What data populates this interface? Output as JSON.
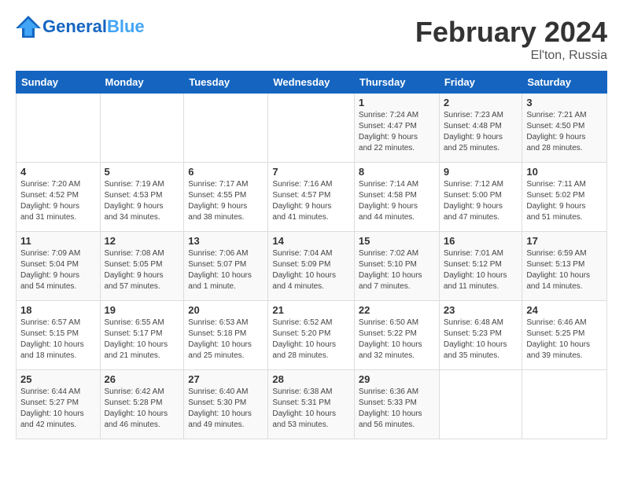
{
  "header": {
    "logo_general": "General",
    "logo_blue": "Blue",
    "month_year": "February 2024",
    "location": "El'ton, Russia"
  },
  "days_of_week": [
    "Sunday",
    "Monday",
    "Tuesday",
    "Wednesday",
    "Thursday",
    "Friday",
    "Saturday"
  ],
  "weeks": [
    [
      {
        "day": "",
        "info": ""
      },
      {
        "day": "",
        "info": ""
      },
      {
        "day": "",
        "info": ""
      },
      {
        "day": "",
        "info": ""
      },
      {
        "day": "1",
        "info": "Sunrise: 7:24 AM\nSunset: 4:47 PM\nDaylight: 9 hours\nand 22 minutes."
      },
      {
        "day": "2",
        "info": "Sunrise: 7:23 AM\nSunset: 4:48 PM\nDaylight: 9 hours\nand 25 minutes."
      },
      {
        "day": "3",
        "info": "Sunrise: 7:21 AM\nSunset: 4:50 PM\nDaylight: 9 hours\nand 28 minutes."
      }
    ],
    [
      {
        "day": "4",
        "info": "Sunrise: 7:20 AM\nSunset: 4:52 PM\nDaylight: 9 hours\nand 31 minutes."
      },
      {
        "day": "5",
        "info": "Sunrise: 7:19 AM\nSunset: 4:53 PM\nDaylight: 9 hours\nand 34 minutes."
      },
      {
        "day": "6",
        "info": "Sunrise: 7:17 AM\nSunset: 4:55 PM\nDaylight: 9 hours\nand 38 minutes."
      },
      {
        "day": "7",
        "info": "Sunrise: 7:16 AM\nSunset: 4:57 PM\nDaylight: 9 hours\nand 41 minutes."
      },
      {
        "day": "8",
        "info": "Sunrise: 7:14 AM\nSunset: 4:58 PM\nDaylight: 9 hours\nand 44 minutes."
      },
      {
        "day": "9",
        "info": "Sunrise: 7:12 AM\nSunset: 5:00 PM\nDaylight: 9 hours\nand 47 minutes."
      },
      {
        "day": "10",
        "info": "Sunrise: 7:11 AM\nSunset: 5:02 PM\nDaylight: 9 hours\nand 51 minutes."
      }
    ],
    [
      {
        "day": "11",
        "info": "Sunrise: 7:09 AM\nSunset: 5:04 PM\nDaylight: 9 hours\nand 54 minutes."
      },
      {
        "day": "12",
        "info": "Sunrise: 7:08 AM\nSunset: 5:05 PM\nDaylight: 9 hours\nand 57 minutes."
      },
      {
        "day": "13",
        "info": "Sunrise: 7:06 AM\nSunset: 5:07 PM\nDaylight: 10 hours\nand 1 minute."
      },
      {
        "day": "14",
        "info": "Sunrise: 7:04 AM\nSunset: 5:09 PM\nDaylight: 10 hours\nand 4 minutes."
      },
      {
        "day": "15",
        "info": "Sunrise: 7:02 AM\nSunset: 5:10 PM\nDaylight: 10 hours\nand 7 minutes."
      },
      {
        "day": "16",
        "info": "Sunrise: 7:01 AM\nSunset: 5:12 PM\nDaylight: 10 hours\nand 11 minutes."
      },
      {
        "day": "17",
        "info": "Sunrise: 6:59 AM\nSunset: 5:13 PM\nDaylight: 10 hours\nand 14 minutes."
      }
    ],
    [
      {
        "day": "18",
        "info": "Sunrise: 6:57 AM\nSunset: 5:15 PM\nDaylight: 10 hours\nand 18 minutes."
      },
      {
        "day": "19",
        "info": "Sunrise: 6:55 AM\nSunset: 5:17 PM\nDaylight: 10 hours\nand 21 minutes."
      },
      {
        "day": "20",
        "info": "Sunrise: 6:53 AM\nSunset: 5:18 PM\nDaylight: 10 hours\nand 25 minutes."
      },
      {
        "day": "21",
        "info": "Sunrise: 6:52 AM\nSunset: 5:20 PM\nDaylight: 10 hours\nand 28 minutes."
      },
      {
        "day": "22",
        "info": "Sunrise: 6:50 AM\nSunset: 5:22 PM\nDaylight: 10 hours\nand 32 minutes."
      },
      {
        "day": "23",
        "info": "Sunrise: 6:48 AM\nSunset: 5:23 PM\nDaylight: 10 hours\nand 35 minutes."
      },
      {
        "day": "24",
        "info": "Sunrise: 6:46 AM\nSunset: 5:25 PM\nDaylight: 10 hours\nand 39 minutes."
      }
    ],
    [
      {
        "day": "25",
        "info": "Sunrise: 6:44 AM\nSunset: 5:27 PM\nDaylight: 10 hours\nand 42 minutes."
      },
      {
        "day": "26",
        "info": "Sunrise: 6:42 AM\nSunset: 5:28 PM\nDaylight: 10 hours\nand 46 minutes."
      },
      {
        "day": "27",
        "info": "Sunrise: 6:40 AM\nSunset: 5:30 PM\nDaylight: 10 hours\nand 49 minutes."
      },
      {
        "day": "28",
        "info": "Sunrise: 6:38 AM\nSunset: 5:31 PM\nDaylight: 10 hours\nand 53 minutes."
      },
      {
        "day": "29",
        "info": "Sunrise: 6:36 AM\nSunset: 5:33 PM\nDaylight: 10 hours\nand 56 minutes."
      },
      {
        "day": "",
        "info": ""
      },
      {
        "day": "",
        "info": ""
      }
    ]
  ]
}
